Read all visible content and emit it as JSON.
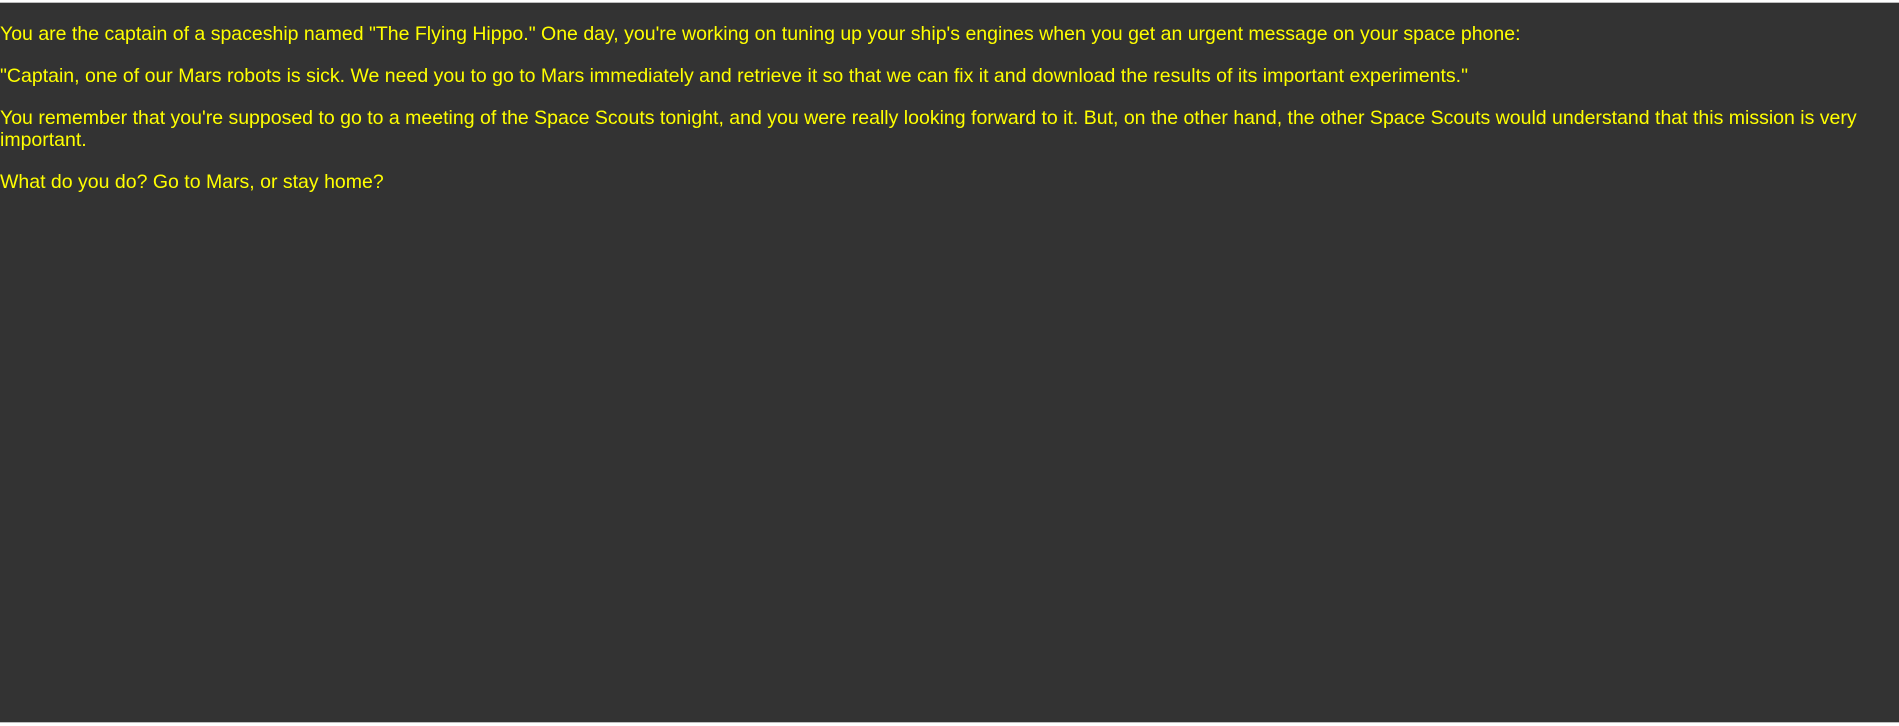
{
  "story": {
    "paragraphs": [
      "You are the captain of a spaceship named \"The Flying Hippo.\" One day, you're working on tuning up your ship's engines when you get an urgent message on your space phone:",
      "\"Captain, one of our Mars robots is sick. We need you to go to Mars immediately and retrieve it so that we can fix it and download the results of its important experiments.\"",
      "You remember that you're supposed to go to a meeting of the Space Scouts tonight, and you were really looking forward to it. But, on the other hand, the other Space Scouts would understand that this mission is very important.",
      "What do you do? Go to Mars, or stay home?"
    ]
  },
  "colors": {
    "background": "#333333",
    "text": "#ffff00",
    "frame_border": "#bdbdbd"
  }
}
